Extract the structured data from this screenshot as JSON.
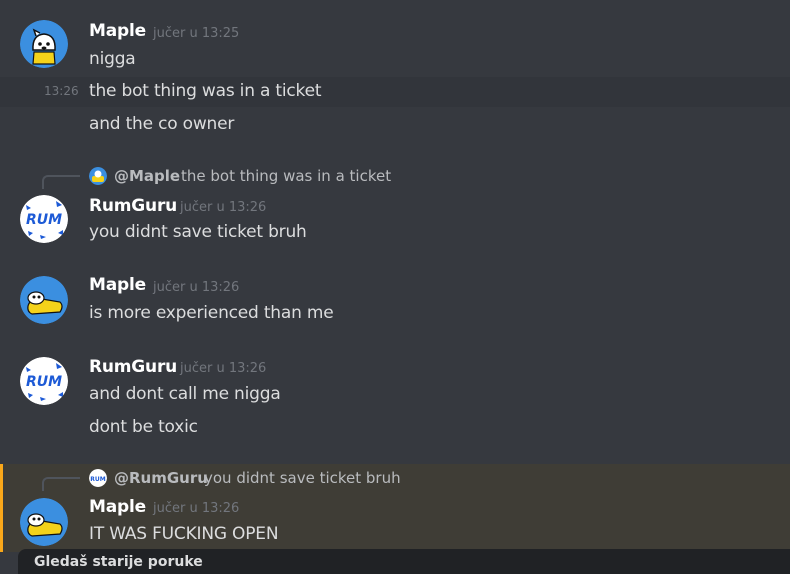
{
  "messages": [
    {
      "author": "Maple",
      "timestamp": "jučer u 13:25",
      "lines": [
        {
          "text": "nigga"
        },
        {
          "text": "the bot thing was in a ticket",
          "inline_time": "13:26"
        },
        {
          "text": "and the co owner"
        }
      ]
    },
    {
      "reply": {
        "mention": "@Maple",
        "text": "the bot thing was in a ticket"
      },
      "author": "RumGuru",
      "timestamp": "jučer u 13:26",
      "lines": [
        {
          "text": "you didnt save ticket bruh"
        }
      ]
    },
    {
      "author": "Maple",
      "timestamp": "jučer u 13:26",
      "lines": [
        {
          "text": "is more experienced than me"
        }
      ]
    },
    {
      "author": "RumGuru",
      "timestamp": "jučer u 13:26",
      "lines": [
        {
          "text": "and dont call me nigga"
        },
        {
          "text": "dont be toxic"
        }
      ]
    },
    {
      "reply": {
        "mention": "@RumGuru",
        "text": "you didnt save ticket bruh"
      },
      "author": "Maple",
      "timestamp": "jučer u 13:26",
      "lines": [
        {
          "text": "IT WAS FUCKING OPEN"
        }
      ],
      "highlighted": true
    }
  ],
  "footer": {
    "label": "Gledaš starije poruke"
  },
  "colors": {
    "background": "#36393f",
    "mention_highlight": "#faa81a",
    "maple_avatar_bg": "#3b8fe0",
    "rumguru_avatar_text": "#1d5ad6"
  }
}
